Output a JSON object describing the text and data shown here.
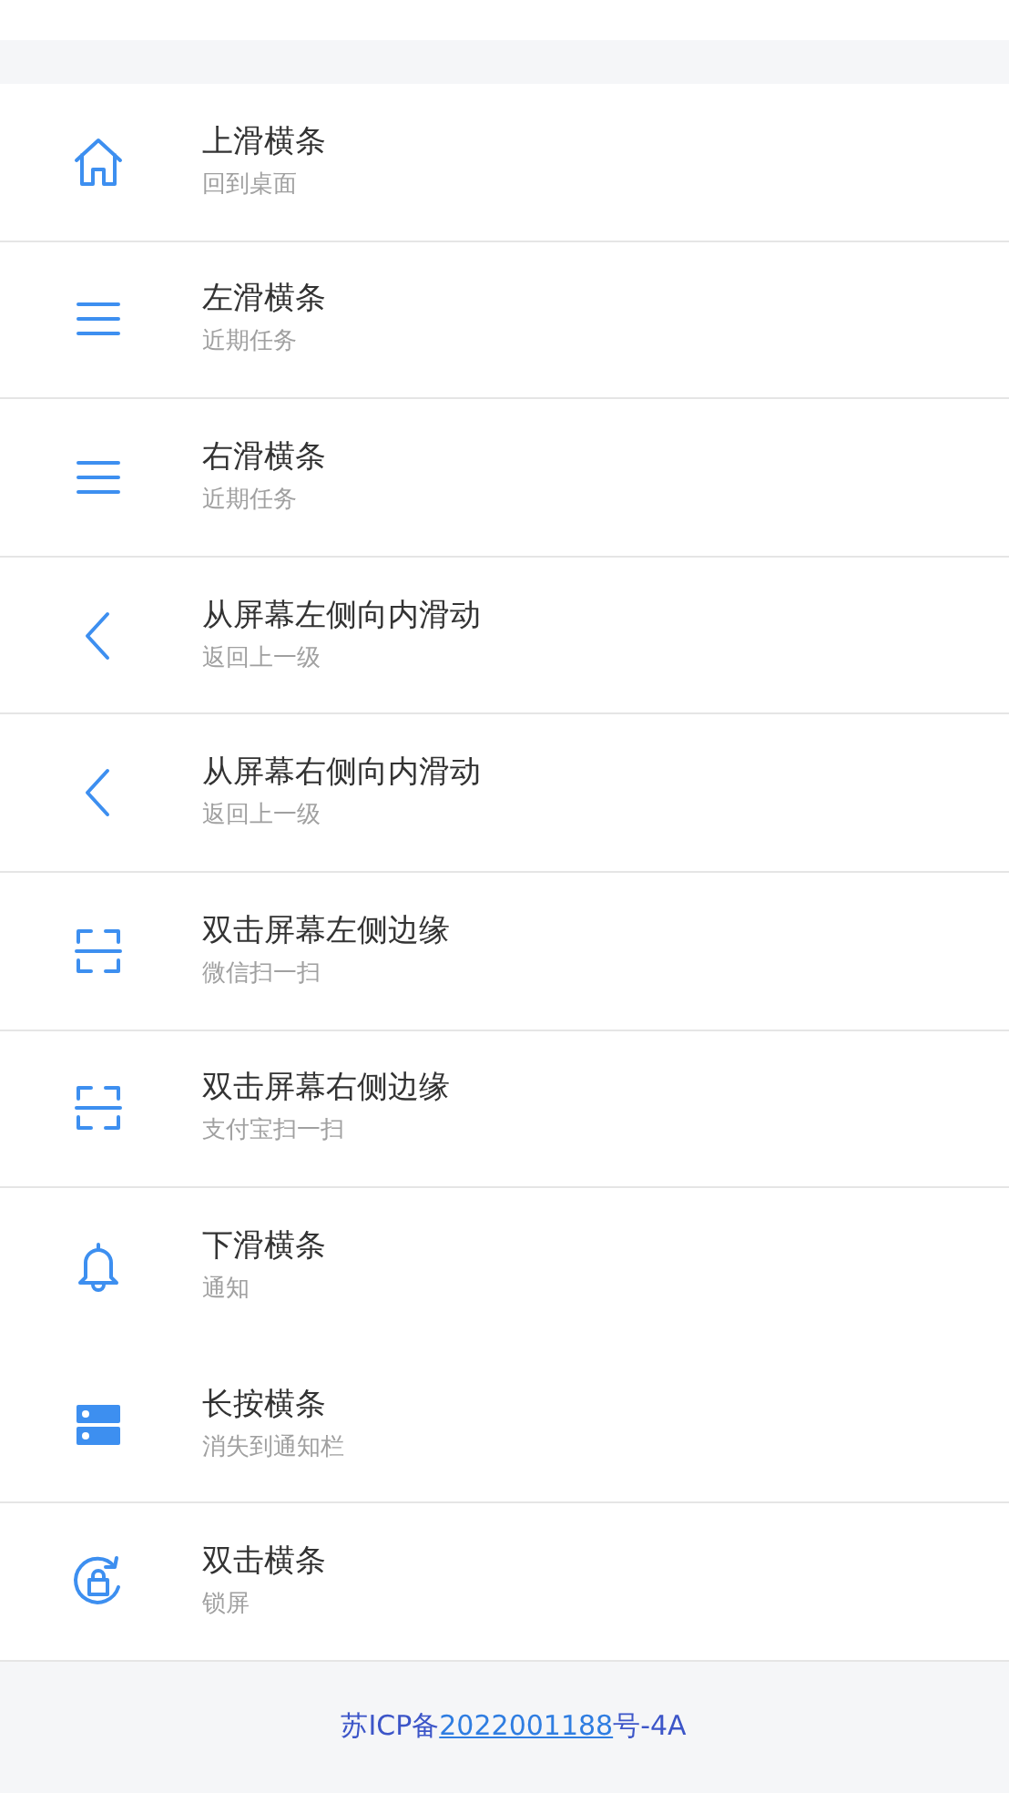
{
  "rows": [
    {
      "kind": "home",
      "title": "上滑横条",
      "subtitle": "回到桌面",
      "divider": true
    },
    {
      "kind": "menu",
      "title": "左滑横条",
      "subtitle": "近期任务",
      "divider": true
    },
    {
      "kind": "menu",
      "title": "右滑横条",
      "subtitle": "近期任务",
      "divider": true
    },
    {
      "kind": "back",
      "title": "从屏幕左侧向内滑动",
      "subtitle": "返回上一级",
      "divider": true
    },
    {
      "kind": "back",
      "title": "从屏幕右侧向内滑动",
      "subtitle": "返回上一级",
      "divider": true
    },
    {
      "kind": "scan",
      "title": "双击屏幕左侧边缘",
      "subtitle": "微信扫一扫",
      "divider": true
    },
    {
      "kind": "scan",
      "title": "双击屏幕右侧边缘",
      "subtitle": "支付宝扫一扫",
      "divider": true
    },
    {
      "kind": "bell",
      "title": "下滑横条",
      "subtitle": "通知",
      "divider": false
    },
    {
      "kind": "stack",
      "title": "长按横条",
      "subtitle": "消失到通知栏",
      "divider": true
    },
    {
      "kind": "lock",
      "title": "双击横条",
      "subtitle": "锁屏",
      "divider": true
    }
  ],
  "footer": {
    "prefix": "苏ICP备",
    "link": "2022001188",
    "suffix": "号-4A"
  }
}
